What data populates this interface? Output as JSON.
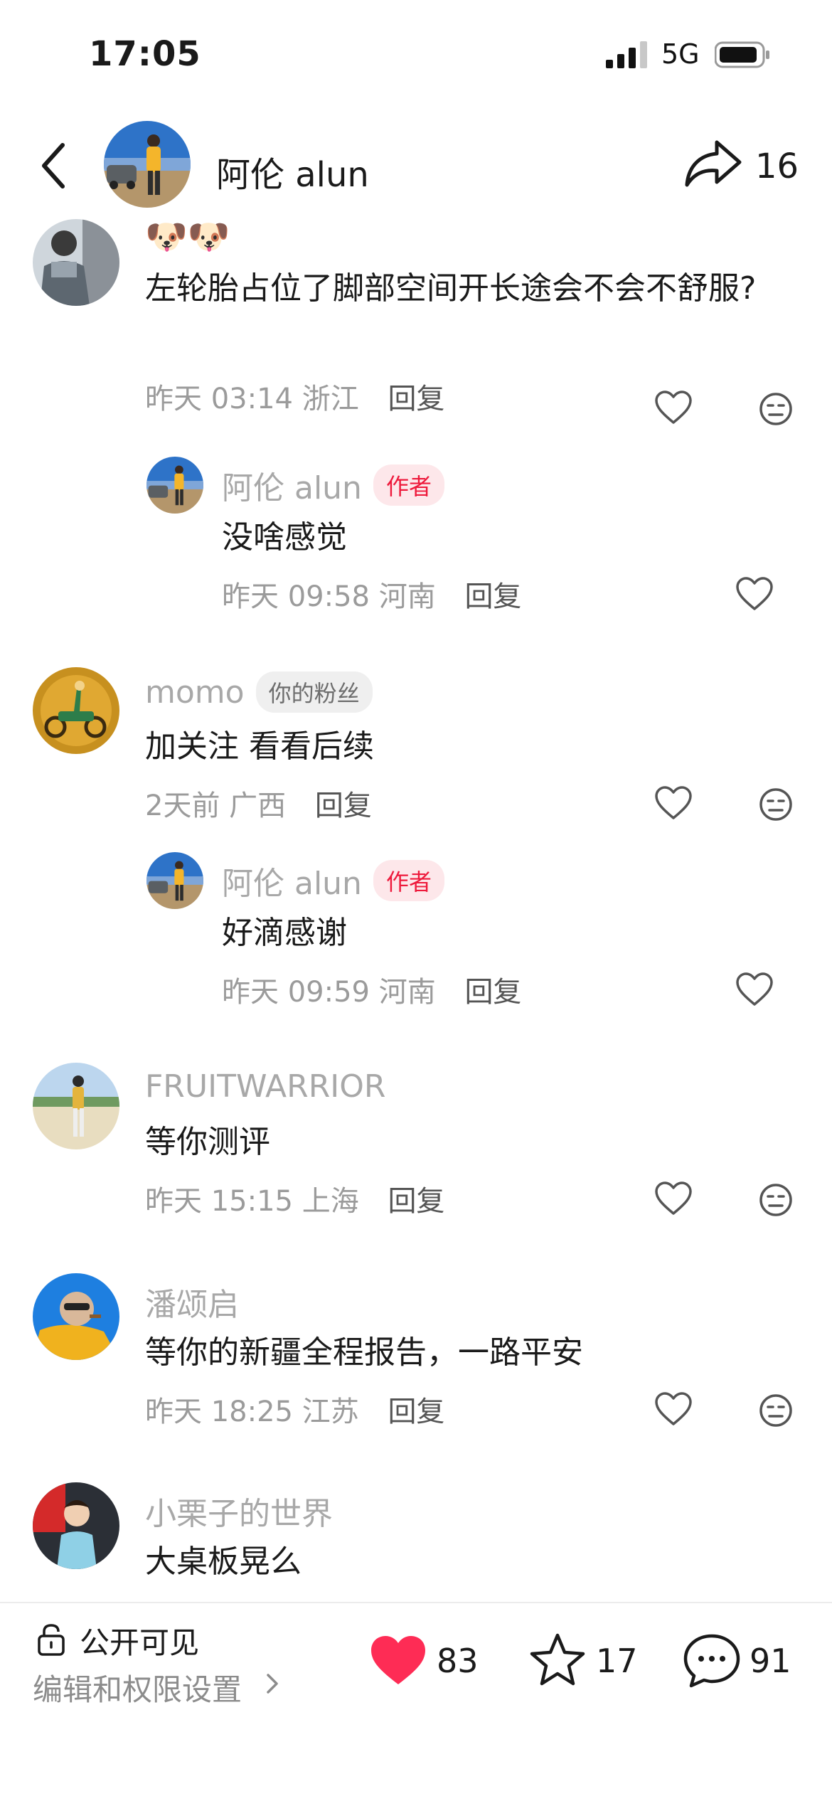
{
  "status_bar": {
    "time": "17:05",
    "network": "5G"
  },
  "header": {
    "author_name": "阿伦 alun",
    "share_count": "16"
  },
  "comments": [
    {
      "emoji": "🐶🐶",
      "text": "左轮胎占位了脚部空间开长途会不会不舒服?",
      "time": "昨天 03:14",
      "location": "浙江",
      "reply_label": "回复",
      "reply": {
        "name": "阿伦 alun",
        "badge": "作者",
        "text": "没啥感觉",
        "time": "昨天 09:58",
        "location": "河南",
        "reply_label": "回复"
      }
    },
    {
      "name": "momo",
      "badge": "你的粉丝",
      "text": "加关注 看看后续",
      "time": "2天前",
      "location": "广西",
      "reply_label": "回复",
      "reply": {
        "name": "阿伦 alun",
        "badge": "作者",
        "text": "好滴感谢",
        "time": "昨天 09:59",
        "location": "河南",
        "reply_label": "回复"
      }
    },
    {
      "name": "FRUITWARRIOR",
      "text": "等你测评",
      "time": "昨天 15:15",
      "location": "上海",
      "reply_label": "回复"
    },
    {
      "name": "潘颂启",
      "text": "等你的新疆全程报告，一路平安",
      "time": "昨天 18:25",
      "location": "江苏",
      "reply_label": "回复"
    },
    {
      "name": "小栗子的世界",
      "text": "大桌板晃么"
    }
  ],
  "bottom_bar": {
    "visibility": "公开可见",
    "edit_label": "编辑和权限设置",
    "likes": "83",
    "favorites": "17",
    "comments": "91"
  },
  "colors": {
    "like_red": "#fe2c55",
    "author_badge": "#ee1a3c"
  }
}
